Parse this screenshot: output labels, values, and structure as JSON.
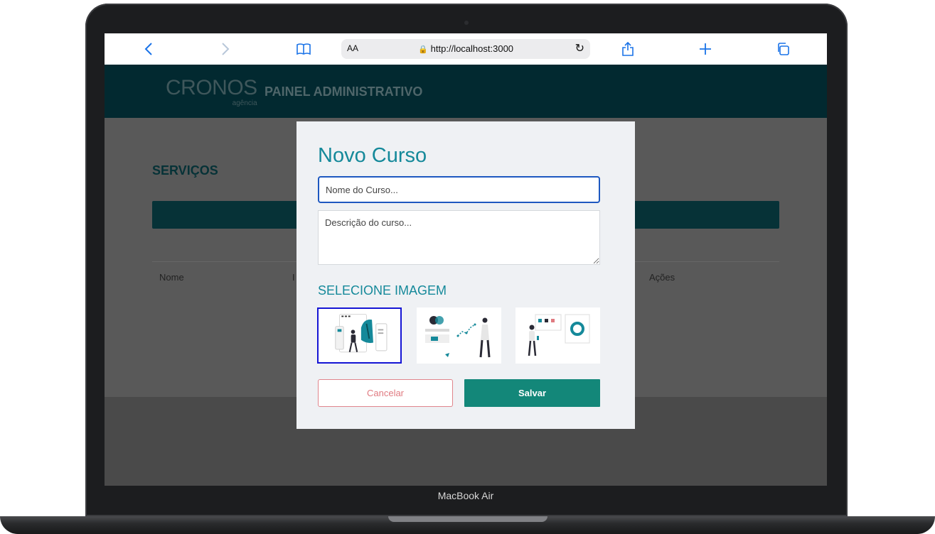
{
  "device": {
    "label": "MacBook Air"
  },
  "browser": {
    "text_size_label": "AA",
    "url": "http://localhost:3000",
    "icons": [
      "back-icon",
      "forward-icon",
      "bookmarks-icon",
      "lock-icon",
      "reload-icon",
      "share-icon",
      "new-tab-icon",
      "tabs-icon"
    ]
  },
  "header": {
    "logo_main": "CRONOS",
    "logo_sub": "agência",
    "title": "PAINEL ADMINISTRATIVO"
  },
  "page": {
    "section_title": "SERVIÇOS",
    "table_headers": [
      "Nome",
      "I",
      "Ações"
    ]
  },
  "modal": {
    "title": "Novo Curso",
    "name_placeholder": "Nome do Curso...",
    "name_value": "",
    "description_placeholder": "Descrição do curso...",
    "image_section_title": "SELECIONE IMAGEM",
    "images": [
      {
        "name": "illustration-web-design",
        "selected": true
      },
      {
        "name": "illustration-analytics",
        "selected": false
      },
      {
        "name": "illustration-presentation",
        "selected": false
      }
    ],
    "cancel_label": "Cancelar",
    "save_label": "Salvar"
  },
  "colors": {
    "header_bg": "#022930",
    "accent_teal": "#15899a",
    "save_button": "#138779",
    "cancel_border": "#e0858c",
    "selected_border": "#1515d4"
  }
}
